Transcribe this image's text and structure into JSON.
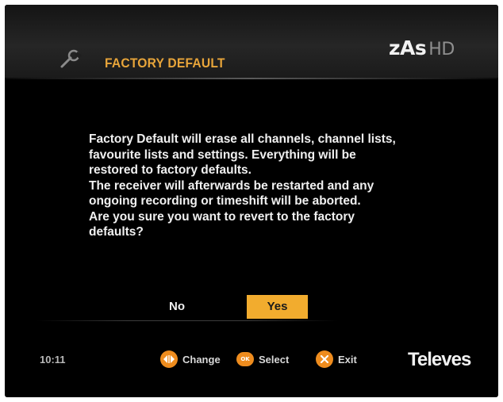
{
  "header": {
    "title": "FACTORY DEFAULT",
    "icon": "wrench-icon",
    "brand": {
      "name": "zAs",
      "suffix": "HD"
    }
  },
  "dialog": {
    "message_lines": [
      "Factory Default will erase all channels, channel lists,",
      "favourite lists and settings. Everything will be",
      "restored to factory defaults.",
      "The receiver will afterwards be restarted and any",
      "ongoing recording or timeshift will be aborted.",
      "Are you sure you want to revert to the factory",
      "defaults?"
    ],
    "buttons": {
      "no": "No",
      "yes": "Yes",
      "selected": "yes"
    }
  },
  "footer": {
    "time": "10:11",
    "hints": [
      {
        "icon": "left-right-arrow-icon",
        "label": "Change"
      },
      {
        "icon": "ok-icon",
        "icon_text": "OK",
        "label": "Select"
      },
      {
        "icon": "exit-cross-icon",
        "label": "Exit"
      }
    ],
    "brand": "Televes"
  },
  "colors": {
    "accent": "#f2ac2e",
    "title": "#e8a53a",
    "key_icon": "#ee8c1e",
    "background": "#000000",
    "text": "#f0f0f0"
  }
}
